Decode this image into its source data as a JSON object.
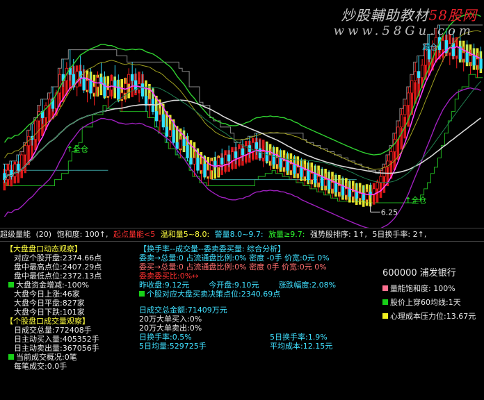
{
  "watermark": {
    "prefix": "炒股輔助教材",
    "brand": "58股网",
    "url": "www.58Gu.com"
  },
  "chart_data": {
    "type": "bar",
    "title": "",
    "xlabel": "",
    "ylabel": "",
    "ylim": [
      5.8,
      12.0
    ],
    "annotations": [
      {
        "text": "↑全仓",
        "index": 18,
        "price": 7.9
      },
      {
        "text": "减仓",
        "index": 121,
        "price": 11.2
      },
      {
        "text": "↑全仓",
        "index": 116,
        "price": 6.25
      },
      {
        "text": "6.25",
        "index": 106,
        "price": 5.9
      }
    ],
    "low_label": "6.25",
    "candles": [
      [
        7.2,
        7.5,
        6.9,
        7.0
      ],
      [
        7.0,
        7.4,
        6.8,
        7.3
      ],
      [
        7.3,
        7.6,
        7.0,
        7.1
      ],
      [
        7.1,
        7.6,
        7.0,
        7.5
      ],
      [
        7.5,
        7.8,
        7.2,
        7.3
      ],
      [
        7.3,
        7.9,
        7.2,
        7.8
      ],
      [
        7.8,
        8.2,
        7.6,
        8.1
      ],
      [
        8.1,
        8.6,
        7.9,
        8.4
      ],
      [
        8.4,
        8.8,
        8.1,
        8.3
      ],
      [
        8.3,
        9.0,
        8.2,
        8.9
      ],
      [
        8.9,
        9.4,
        8.7,
        9.2
      ],
      [
        9.2,
        9.6,
        8.8,
        9.0
      ],
      [
        9.0,
        9.5,
        8.7,
        9.4
      ],
      [
        9.4,
        9.8,
        9.1,
        9.6
      ],
      [
        9.6,
        10.0,
        9.2,
        9.3
      ],
      [
        9.3,
        9.9,
        9.1,
        9.8
      ],
      [
        9.8,
        10.6,
        9.6,
        10.4
      ],
      [
        10.4,
        10.9,
        10.0,
        10.2
      ],
      [
        10.2,
        10.8,
        9.9,
        10.6
      ],
      [
        10.6,
        11.2,
        10.2,
        10.4
      ],
      [
        10.4,
        10.9,
        9.9,
        10.0
      ],
      [
        10.0,
        10.6,
        9.7,
        10.5
      ],
      [
        10.5,
        11.0,
        10.1,
        10.3
      ],
      [
        10.3,
        10.7,
        9.8,
        9.9
      ],
      [
        9.9,
        10.4,
        9.5,
        10.2
      ],
      [
        10.2,
        10.6,
        9.6,
        9.8
      ],
      [
        9.8,
        10.2,
        9.4,
        10.0
      ],
      [
        10.0,
        10.5,
        9.7,
        10.3
      ],
      [
        10.3,
        10.8,
        9.9,
        10.1
      ],
      [
        10.1,
        10.5,
        9.6,
        9.7
      ],
      [
        9.7,
        10.1,
        9.3,
        9.9
      ],
      [
        9.9,
        10.4,
        9.6,
        10.2
      ],
      [
        10.2,
        10.7,
        9.8,
        10.0
      ],
      [
        10.0,
        10.4,
        9.5,
        9.6
      ],
      [
        9.6,
        10.0,
        9.2,
        9.8
      ],
      [
        9.8,
        10.3,
        9.5,
        10.1
      ],
      [
        10.1,
        10.6,
        9.8,
        10.4
      ],
      [
        10.4,
        10.8,
        10.0,
        10.2
      ],
      [
        10.2,
        10.6,
        9.8,
        9.9
      ],
      [
        9.9,
        10.3,
        9.5,
        10.1
      ],
      [
        10.1,
        10.5,
        9.6,
        9.7
      ],
      [
        9.7,
        10.0,
        9.2,
        9.4
      ],
      [
        9.4,
        9.8,
        9.0,
        9.6
      ],
      [
        9.6,
        10.0,
        9.1,
        9.2
      ],
      [
        9.2,
        9.5,
        8.7,
        8.9
      ],
      [
        8.9,
        9.3,
        8.5,
        9.1
      ],
      [
        9.1,
        9.4,
        8.6,
        8.7
      ],
      [
        8.7,
        9.0,
        8.2,
        8.4
      ],
      [
        8.4,
        8.8,
        8.0,
        8.6
      ],
      [
        8.6,
        8.9,
        8.1,
        8.2
      ],
      [
        8.2,
        8.6,
        7.8,
        8.0
      ],
      [
        8.0,
        8.4,
        7.7,
        8.3
      ],
      [
        8.3,
        8.7,
        7.9,
        8.1
      ],
      [
        8.1,
        8.5,
        7.6,
        7.7
      ],
      [
        7.7,
        8.1,
        7.3,
        7.5
      ],
      [
        7.5,
        7.9,
        7.1,
        7.7
      ],
      [
        7.7,
        8.0,
        7.2,
        7.3
      ],
      [
        7.3,
        7.7,
        6.9,
        7.5
      ],
      [
        7.5,
        7.8,
        7.0,
        7.1
      ],
      [
        7.1,
        7.5,
        6.8,
        7.3
      ],
      [
        7.3,
        7.7,
        7.0,
        7.6
      ],
      [
        7.6,
        7.9,
        7.2,
        7.4
      ],
      [
        7.4,
        7.8,
        7.1,
        7.7
      ],
      [
        7.7,
        8.0,
        7.3,
        7.5
      ],
      [
        7.5,
        7.9,
        7.2,
        7.8
      ],
      [
        7.8,
        8.1,
        7.4,
        7.6
      ],
      [
        7.6,
        8.0,
        7.3,
        7.9
      ],
      [
        7.9,
        8.2,
        7.5,
        7.7
      ],
      [
        7.7,
        8.1,
        7.4,
        8.0
      ],
      [
        8.0,
        8.3,
        7.6,
        7.8
      ],
      [
        7.8,
        8.2,
        7.5,
        8.1
      ],
      [
        8.1,
        8.4,
        7.7,
        7.9
      ],
      [
        7.9,
        8.3,
        7.6,
        8.2
      ],
      [
        8.2,
        8.5,
        7.8,
        8.0
      ],
      [
        8.0,
        8.3,
        7.6,
        7.7
      ],
      [
        7.7,
        8.1,
        7.4,
        7.9
      ],
      [
        7.9,
        8.2,
        7.5,
        7.6
      ],
      [
        7.6,
        8.0,
        7.3,
        7.8
      ],
      [
        7.8,
        8.1,
        7.4,
        7.5
      ],
      [
        7.5,
        7.9,
        7.2,
        7.7
      ],
      [
        7.7,
        8.0,
        7.3,
        7.4
      ],
      [
        7.4,
        7.8,
        7.1,
        7.6
      ],
      [
        7.6,
        7.9,
        7.2,
        7.3
      ],
      [
        7.3,
        7.7,
        7.0,
        7.5
      ],
      [
        7.5,
        7.8,
        7.1,
        7.2
      ],
      [
        7.2,
        7.6,
        6.9,
        7.4
      ],
      [
        7.4,
        7.7,
        7.0,
        7.1
      ],
      [
        7.1,
        7.5,
        6.8,
        7.3
      ],
      [
        7.3,
        7.6,
        6.9,
        7.0
      ],
      [
        7.0,
        7.4,
        6.7,
        7.2
      ],
      [
        7.2,
        7.5,
        6.8,
        6.9
      ],
      [
        6.9,
        7.3,
        6.6,
        7.1
      ],
      [
        7.1,
        7.4,
        6.7,
        6.8
      ],
      [
        6.8,
        7.2,
        6.5,
        7.0
      ],
      [
        7.0,
        7.3,
        6.6,
        6.7
      ],
      [
        6.7,
        7.1,
        6.4,
        6.9
      ],
      [
        6.9,
        7.2,
        6.5,
        6.6
      ],
      [
        6.6,
        7.0,
        6.3,
        6.8
      ],
      [
        6.8,
        7.1,
        6.4,
        6.5
      ],
      [
        6.5,
        6.9,
        6.3,
        6.7
      ],
      [
        6.7,
        7.0,
        6.35,
        6.45
      ],
      [
        6.45,
        6.8,
        6.3,
        6.6
      ],
      [
        6.6,
        6.9,
        6.3,
        6.4
      ],
      [
        6.4,
        6.75,
        6.28,
        6.55
      ],
      [
        6.55,
        6.8,
        6.3,
        6.35
      ],
      [
        6.35,
        6.7,
        6.25,
        6.6
      ],
      [
        6.6,
        6.9,
        6.4,
        6.5
      ],
      [
        6.5,
        6.8,
        6.3,
        6.7
      ],
      [
        6.7,
        7.0,
        6.5,
        6.9
      ],
      [
        6.9,
        7.3,
        6.7,
        7.1
      ],
      [
        7.1,
        7.5,
        6.9,
        7.4
      ],
      [
        7.4,
        7.8,
        7.2,
        7.6
      ],
      [
        7.6,
        8.1,
        7.4,
        7.9
      ],
      [
        7.9,
        8.5,
        7.7,
        8.3
      ],
      [
        8.3,
        8.9,
        8.1,
        8.7
      ],
      [
        8.7,
        9.3,
        8.5,
        9.1
      ],
      [
        9.1,
        9.6,
        8.9,
        9.4
      ],
      [
        9.4,
        10.0,
        9.2,
        9.8
      ],
      [
        9.8,
        10.4,
        9.6,
        10.2
      ],
      [
        10.2,
        10.8,
        9.9,
        10.5
      ],
      [
        10.5,
        11.0,
        10.1,
        10.3
      ],
      [
        10.3,
        10.9,
        10.0,
        10.7
      ],
      [
        10.7,
        11.4,
        10.4,
        11.2
      ],
      [
        11.2,
        11.7,
        10.8,
        10.9
      ],
      [
        10.9,
        11.5,
        10.6,
        11.3
      ],
      [
        11.3,
        11.9,
        11.0,
        11.6
      ],
      [
        11.6,
        12.0,
        11.1,
        11.2
      ],
      [
        11.2,
        11.7,
        10.8,
        11.5
      ],
      [
        11.5,
        11.9,
        11.0,
        11.1
      ],
      [
        11.1,
        11.6,
        10.7,
        11.4
      ],
      [
        11.4,
        11.8,
        10.9,
        11.0
      ],
      [
        11.0,
        11.5,
        10.6,
        11.3
      ],
      [
        11.3,
        11.7,
        10.8,
        10.9
      ],
      [
        10.9,
        11.3,
        10.5,
        11.1
      ],
      [
        11.1,
        11.5,
        10.7,
        10.8
      ],
      [
        10.8,
        11.2,
        10.4,
        11.0
      ],
      [
        11.0,
        11.4,
        10.6,
        10.7
      ],
      [
        10.7,
        11.1,
        10.3,
        10.9
      ],
      [
        10.9,
        11.3,
        10.5,
        10.6
      ]
    ]
  },
  "infobar": [
    {
      "text": "超级量能",
      "color": "white"
    },
    {
      "text": "(20)",
      "color": "white"
    },
    {
      "text": "饱和度: 100↑,",
      "color": "white"
    },
    {
      "text": "起点量能<5",
      "color": "red"
    },
    {
      "text": "温和量5~8.0:",
      "color": "yel"
    },
    {
      "text": "警量8.0~9.7:",
      "color": "cyan"
    },
    {
      "text": "放量≥9.7:",
      "color": "grn"
    },
    {
      "text": "强势股排序: 1↑,",
      "color": "white"
    },
    {
      "text": "5日换手率: 2↑,",
      "color": "white"
    }
  ],
  "left_panel": {
    "dapan_title": "【大盘盘口动态观察】",
    "dapan_rows": [
      "对应个股开盘:2374.66点",
      "盘中最高点位:2407.29点",
      "盘中最低点位:2372.13点",
      "大盘资金增减:-100%",
      "大盘今日上涨:46家",
      "大盘今日平盘:827家",
      "大盘今日下跌:101家"
    ],
    "gegu_title": "【个股盘口成交量观察】",
    "gegu_rows": [
      "日成交总量:772408手",
      "日主动买入量:405352手",
      "日主动卖出量:367056手",
      "当前成交概况:0笔",
      "每笔成交:0.0手"
    ]
  },
  "mid_panel": {
    "title": "【换手率--成交量--委卖委买量: 综合分析】",
    "r1": "委卖→总量:0 占流通盘比例:0% 密度 -0手 价宽:0元 0%",
    "r2": "委买→总量:0 占流通盘比例:0% 密度 0手 价宽:0元 0%",
    "r3": "委卖委买比:0%↔",
    "r4a": "昨收盘:9.12元",
    "r4b": "今开盘:9.10元",
    "r4c": "涨跌幅度:2.08%",
    "r5": "个股对应大盘买卖决策点位:2340.69点",
    "r6": "日成交总金额:71409万元",
    "r7": "20万大单买入:0%",
    "r8": "20万大单卖出:0%",
    "r9a": "日换手率:0.5%",
    "r9b": "5日换手率:1.9%",
    "r10a": "5日均量:529725手",
    "r10b": "平均成本:12.15元"
  },
  "right_panel": {
    "stock": "600000 浦发银行",
    "rows": [
      {
        "text": "量能饱和度: 100%",
        "sq": "p"
      },
      {
        "text": "股价上穿60均线:1天",
        "sq": "g"
      },
      {
        "text": "心理成本压力位:13.67元",
        "sq": "y"
      }
    ]
  }
}
